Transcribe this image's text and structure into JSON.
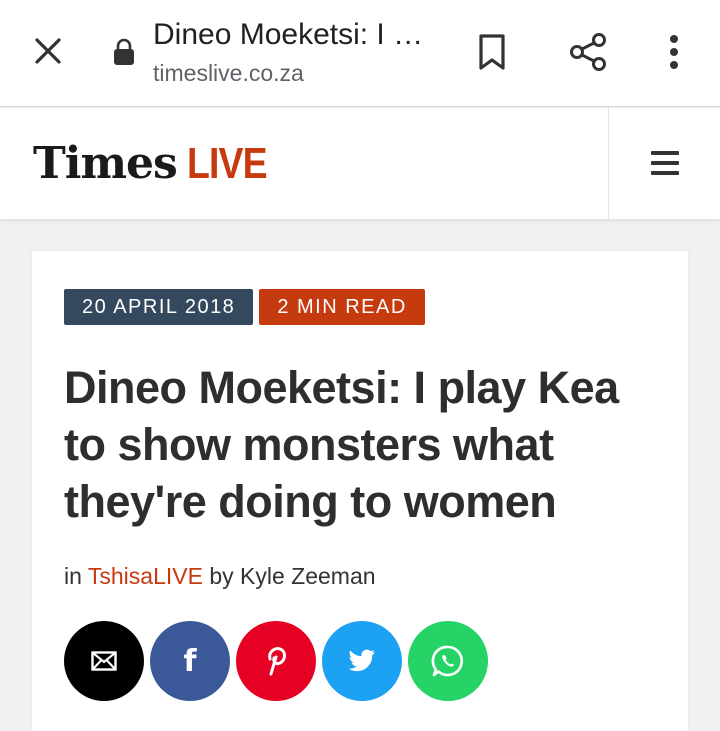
{
  "browser": {
    "tab_title": "Dineo Moeketsi: I play Kea to show monsters what they're doing to women",
    "url": "timeslive.co.za",
    "icons": [
      "close-icon",
      "lock-icon",
      "bookmark-icon",
      "share-icon",
      "more-vert-icon"
    ]
  },
  "site": {
    "logo_times": "Times",
    "logo_live": "LIVE",
    "brand_color": "#c63a10",
    "menu_icon": "hamburger-menu-icon"
  },
  "article": {
    "date": "20 APRIL 2018",
    "read_time": "2 MIN READ",
    "headline": "Dineo Moeketsi: I play Kea to show monsters what they're doing to women",
    "byline_prefix": "in",
    "section": "TshisaLIVE",
    "byline_by": "by Kyle Zeeman",
    "share_buttons": [
      {
        "name": "email",
        "icon": "email-icon",
        "color": "#000000"
      },
      {
        "name": "facebook",
        "icon": "facebook-icon",
        "color": "#3b5998"
      },
      {
        "name": "pinterest",
        "icon": "pinterest-icon",
        "color": "#e60023"
      },
      {
        "name": "twitter",
        "icon": "twitter-icon",
        "color": "#1da1f2"
      },
      {
        "name": "whatsapp",
        "icon": "whatsapp-icon",
        "color": "#25d366"
      }
    ]
  },
  "colors": {
    "date_badge": "#35495e",
    "read_badge": "#c63a10",
    "headline_text": "#2e2e2e"
  }
}
